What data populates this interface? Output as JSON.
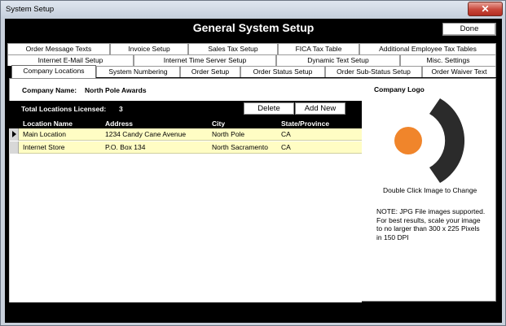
{
  "window": {
    "title": "System Setup"
  },
  "header": {
    "title": "General System Setup",
    "done_label": "Done"
  },
  "tabs": {
    "row1": [
      "Order Message Texts",
      "Invoice Setup",
      "Sales Tax Setup",
      "FICA Tax Table",
      "Additional Employee Tax Tables"
    ],
    "row2": [
      "Internet E-Mail Setup",
      "Internet Time Server Setup",
      "Dynamic Text Setup",
      "Misc. Settings"
    ],
    "row3": [
      "Company Locations",
      "System Numbering",
      "Order Setup",
      "Order Status Setup",
      "Order Sub-Status Setup",
      "Order Waiver Text"
    ]
  },
  "company": {
    "name_label": "Company Name:",
    "name_value": "North Pole Awards"
  },
  "locations": {
    "licensed_label": "Total Locations Licensed:",
    "licensed_value": "3",
    "delete_label": "Delete",
    "add_label": "Add New",
    "columns": [
      "Location Name",
      "Address",
      "City",
      "State/Province"
    ],
    "rows": [
      [
        "Main Location",
        "1234 Candy Cane Avenue",
        "North Pole",
        "CA"
      ],
      [
        "Internet Store",
        "P.O. Box 134",
        "North Sacramento",
        "CA"
      ]
    ]
  },
  "logo": {
    "label": "Company Logo",
    "hint": "Double Click Image to Change",
    "note_lines": [
      "NOTE: JPG File images supported.",
      "For best results, scale your image",
      "to no larger than 300 x 225 Pixels",
      "in 150 DPI"
    ],
    "colors": {
      "circle": "#f0852b",
      "arc": "#2b2b2b"
    }
  }
}
